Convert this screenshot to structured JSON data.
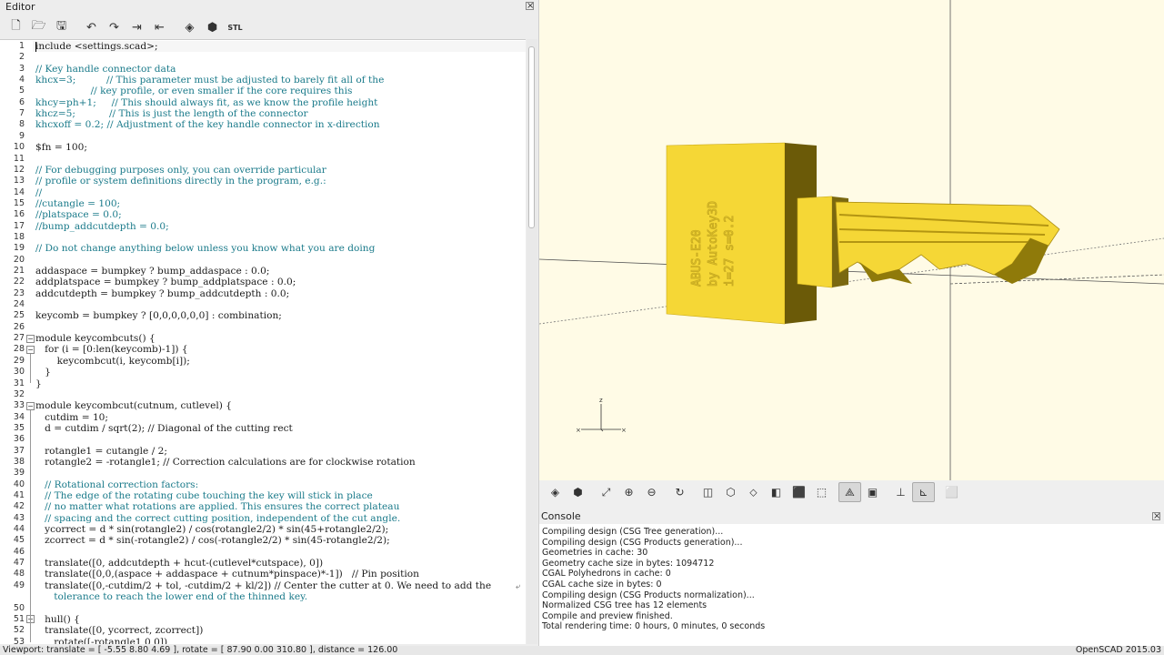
{
  "editor": {
    "title": "Editor",
    "toolbar": [
      {
        "name": "new-file-icon",
        "glyph": "🗋"
      },
      {
        "name": "open-file-icon",
        "glyph": "🗁"
      },
      {
        "name": "save-file-icon",
        "glyph": "🖫"
      },
      {
        "name": "undo-icon",
        "glyph": "↶"
      },
      {
        "name": "redo-icon",
        "glyph": "↷"
      },
      {
        "name": "indent-icon",
        "glyph": "⇥"
      },
      {
        "name": "unindent-icon",
        "glyph": "⇤"
      },
      {
        "name": "preview-icon",
        "glyph": "◈"
      },
      {
        "name": "render-icon",
        "glyph": "⬢"
      },
      {
        "name": "export-stl-icon",
        "glyph": "STL"
      }
    ],
    "lines": [
      {
        "n": "1",
        "t": "include <settings.scad>;",
        "s": "p"
      },
      {
        "n": "2",
        "t": "",
        "s": "p"
      },
      {
        "n": "3",
        "t": "// Key handle connector data",
        "s": "c"
      },
      {
        "n": "4",
        "t": "khcx=3;          // This parameter must be adjusted to barely fit all of the",
        "s": "c"
      },
      {
        "n": "5",
        "t": "                  // key profile, or even smaller if the core requires this",
        "s": "c"
      },
      {
        "n": "6",
        "t": "khcy=ph+1;     // This should always fit, as we know the profile height",
        "s": "c"
      },
      {
        "n": "7",
        "t": "khcz=5;           // This is just the length of the connector",
        "s": "c"
      },
      {
        "n": "8",
        "t": "khcxoff = 0.2; // Adjustment of the key handle connector in x-direction",
        "s": "c"
      },
      {
        "n": "9",
        "t": "",
        "s": "p"
      },
      {
        "n": "10",
        "t": "$fn = 100;",
        "s": "p"
      },
      {
        "n": "11",
        "t": "",
        "s": "p"
      },
      {
        "n": "12",
        "t": "// For debugging purposes only, you can override particular",
        "s": "c"
      },
      {
        "n": "13",
        "t": "// profile or system definitions directly in the program, e.g.:",
        "s": "c"
      },
      {
        "n": "14",
        "t": "//",
        "s": "c"
      },
      {
        "n": "15",
        "t": "//cutangle = 100;",
        "s": "c"
      },
      {
        "n": "16",
        "t": "//platspace = 0.0;",
        "s": "c"
      },
      {
        "n": "17",
        "t": "//bump_addcutdepth = 0.0;",
        "s": "c"
      },
      {
        "n": "18",
        "t": "",
        "s": "p"
      },
      {
        "n": "19",
        "t": "// Do not change anything below unless you know what you are doing",
        "s": "c"
      },
      {
        "n": "20",
        "t": "",
        "s": "p"
      },
      {
        "n": "21",
        "t": "addaspace = bumpkey ? bump_addaspace : 0.0;",
        "s": "p"
      },
      {
        "n": "22",
        "t": "addplatspace = bumpkey ? bump_addplatspace : 0.0;",
        "s": "p"
      },
      {
        "n": "23",
        "t": "addcutdepth = bumpkey ? bump_addcutdepth : 0.0;",
        "s": "p"
      },
      {
        "n": "24",
        "t": "",
        "s": "p"
      },
      {
        "n": "25",
        "t": "keycomb = bumpkey ? [0,0,0,0,0,0] : combination;",
        "s": "p"
      },
      {
        "n": "26",
        "t": "",
        "s": "p"
      },
      {
        "n": "27",
        "t": "module keycombcuts() {",
        "s": "p"
      },
      {
        "n": "28",
        "t": "   for (i = [0:len(keycomb)-1]) {",
        "s": "p"
      },
      {
        "n": "29",
        "t": "       keycombcut(i, keycomb[i]);",
        "s": "p"
      },
      {
        "n": "30",
        "t": "   }",
        "s": "p"
      },
      {
        "n": "31",
        "t": "}",
        "s": "p"
      },
      {
        "n": "32",
        "t": "",
        "s": "p"
      },
      {
        "n": "33",
        "t": "module keycombcut(cutnum, cutlevel) {",
        "s": "p"
      },
      {
        "n": "34",
        "t": "   cutdim = 10;",
        "s": "p"
      },
      {
        "n": "35",
        "t": "   d = cutdim / sqrt(2); // Diagonal of the cutting rect",
        "s": "p"
      },
      {
        "n": "36",
        "t": "",
        "s": "p"
      },
      {
        "n": "37",
        "t": "   rotangle1 = cutangle / 2;",
        "s": "p"
      },
      {
        "n": "38",
        "t": "   rotangle2 = -rotangle1; // Correction calculations are for clockwise rotation",
        "s": "p"
      },
      {
        "n": "39",
        "t": "",
        "s": "p"
      },
      {
        "n": "40",
        "t": "   // Rotational correction factors:",
        "s": "c"
      },
      {
        "n": "41",
        "t": "   // The edge of the rotating cube touching the key will stick in place",
        "s": "c"
      },
      {
        "n": "42",
        "t": "   // no matter what rotations are applied. This ensures the correct plateau",
        "s": "c"
      },
      {
        "n": "43",
        "t": "   // spacing and the correct cutting position, independent of the cut angle.",
        "s": "c"
      },
      {
        "n": "44",
        "t": "   ycorrect = d * sin(rotangle2) / cos(rotangle2/2) * sin(45+rotangle2/2);",
        "s": "p"
      },
      {
        "n": "45",
        "t": "   zcorrect = d * sin(-rotangle2) / cos(-rotangle2/2) * sin(45-rotangle2/2);",
        "s": "p"
      },
      {
        "n": "46",
        "t": "",
        "s": "p"
      },
      {
        "n": "47",
        "t": "   translate([0, addcutdepth + hcut-(cutlevel*cutspace), 0])",
        "s": "p"
      },
      {
        "n": "48",
        "t": "   translate([0,0,(aspace + addaspace + cutnum*pinspace)*-1])   // Pin position",
        "s": "p"
      },
      {
        "n": "49",
        "t": "   translate([0,-cutdim/2 + tol, -cutdim/2 + kl/2]) // Center the cutter at 0. We need to add the",
        "s": "p"
      },
      {
        "n": "",
        "t": "      tolerance to reach the lower end of the thinned key.",
        "s": "c"
      },
      {
        "n": "50",
        "t": "",
        "s": "p"
      },
      {
        "n": "51",
        "t": "   hull() {",
        "s": "p"
      },
      {
        "n": "52",
        "t": "   translate([0, ycorrect, zcorrect])",
        "s": "p"
      },
      {
        "n": "53",
        "t": "      rotate([-rotangle1,0,0])",
        "s": "p"
      }
    ]
  },
  "viewport": {
    "key_engraving": [
      "ABUS-E20",
      "by AutoKey3D",
      "i=27 s=0.2"
    ],
    "axis_label": "z"
  },
  "view_toolbar": [
    {
      "name": "preview-icon",
      "glyph": "◈"
    },
    {
      "name": "render-icon",
      "glyph": "⬢"
    },
    {
      "name": "view-all-icon",
      "glyph": "⤢"
    },
    {
      "name": "zoom-in-icon",
      "glyph": "⊕"
    },
    {
      "name": "zoom-out-icon",
      "glyph": "⊖"
    },
    {
      "name": "reset-view-icon",
      "glyph": "↻"
    },
    {
      "name": "view-right-icon",
      "glyph": "◫"
    },
    {
      "name": "view-top-icon",
      "glyph": "⬡"
    },
    {
      "name": "view-bottom-icon",
      "glyph": "⬦"
    },
    {
      "name": "view-left-icon",
      "glyph": "◧"
    },
    {
      "name": "view-front-icon",
      "glyph": "⬛"
    },
    {
      "name": "view-back-icon",
      "glyph": "⬚"
    },
    {
      "name": "perspective-icon",
      "glyph": "⟁"
    },
    {
      "name": "orthogonal-icon",
      "glyph": "▣"
    },
    {
      "name": "show-axes-icon",
      "glyph": "⊥"
    },
    {
      "name": "show-scale-icon",
      "glyph": "⊾"
    },
    {
      "name": "show-edges-icon",
      "glyph": "⬜"
    }
  ],
  "console": {
    "title": "Console",
    "lines": [
      "Compiling design (CSG Tree generation)...",
      "Compiling design (CSG Products generation)...",
      "Geometries in cache: 30",
      "Geometry cache size in bytes: 1094712",
      "CGAL Polyhedrons in cache: 0",
      "CGAL cache size in bytes: 0",
      "Compiling design (CSG Products normalization)...",
      "Normalized CSG tree has 12 elements",
      "Compile and preview finished.",
      "Total rendering time: 0 hours, 0 minutes, 0 seconds"
    ]
  },
  "status": {
    "viewport": "Viewport: translate = [ -5.55 8.80 4.69 ], rotate = [ 87.90 0.00 310.80 ], distance = 126.00",
    "version": "OpenSCAD 2015.03"
  },
  "colors": {
    "key": "#f5d736",
    "key_shadow": "#6b5a08",
    "bg3d": "#fffbe6"
  }
}
